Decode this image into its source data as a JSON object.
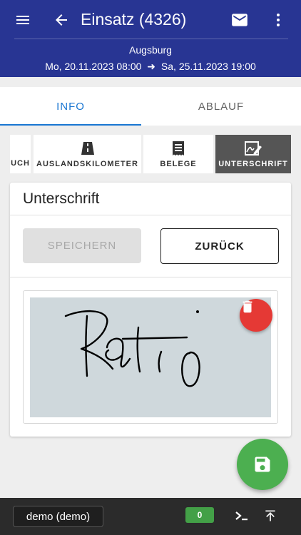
{
  "appbar": {
    "title": "Einsatz (4326)",
    "location": "Augsburg",
    "date_start": "Mo, 20.11.2023 08:00",
    "date_arrow": "➜",
    "date_end": "Sa, 25.11.2023 19:00",
    "icons": [
      "menu-icon",
      "back-arrow-icon",
      "mail-icon",
      "more-vert-icon"
    ],
    "color": "#283593"
  },
  "tabs": [
    {
      "label": "INFO",
      "active": true
    },
    {
      "label": "ABLAUF",
      "active": false
    }
  ],
  "chips": [
    {
      "label": "UCH",
      "icon": "",
      "active": false
    },
    {
      "label": "AUSLANDSKILOMETER",
      "icon": "road-icon",
      "active": false
    },
    {
      "label": "BELEGE",
      "icon": "receipt-icon",
      "active": false
    },
    {
      "label": "UNTERSCHRIFT",
      "icon": "signature-icon",
      "active": true
    }
  ],
  "card": {
    "title": "Unterschrift",
    "save_label": "SPEICHERN",
    "back_label": "ZURÜCK",
    "save_enabled": false,
    "signature_text": "Ratio"
  },
  "bottombar": {
    "user": "demo (demo)",
    "count": "0",
    "icons": [
      "terminal-icon",
      "scroll-top-icon"
    ]
  },
  "colors": {
    "primary": "#283593",
    "accent": "#1976d2",
    "delete": "#e53935",
    "fab": "#4caf50",
    "badge": "#43a047"
  }
}
